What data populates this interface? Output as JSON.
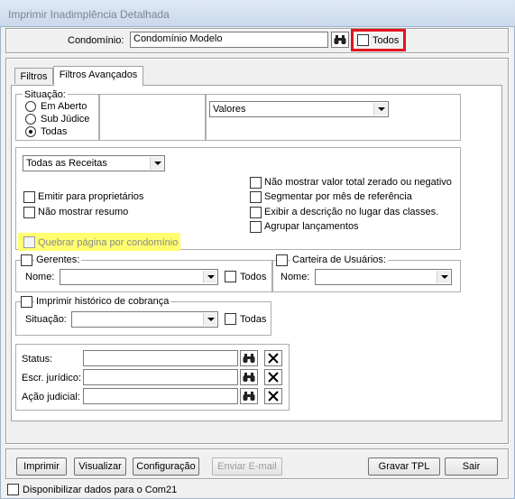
{
  "window": {
    "title": "Imprimir Inadimplência Detalhada"
  },
  "condominio": {
    "label": "Condomínio:",
    "value": "Condomínio Modelo",
    "todos_label": "Todos"
  },
  "tabs": [
    {
      "label": "Filtros"
    },
    {
      "label": "Filtros Avançados"
    }
  ],
  "situacao": {
    "label": "Situação:",
    "options": [
      "Em Aberto",
      "Sub Júdice",
      "Todas"
    ],
    "selected": "Todas"
  },
  "valores_combo": "Valores",
  "receitas_combo": "Todas as Receitas",
  "options_left": [
    "Emitir para proprietários",
    "Não mostrar resumo"
  ],
  "options_right": [
    "Não mostrar valor total zerado ou negativo",
    "Segmentar por mês de referência",
    "Exibir a descrição no lugar das classes.",
    "Agrupar lançamentos"
  ],
  "quebrar_pagina": "Quebrar página por condomínio",
  "gerentes": {
    "label": "Gerentes:",
    "nome_label": "Nome:",
    "todos_label": "Todos"
  },
  "carteira": {
    "label": "Carteira de Usuários:",
    "nome_label": "Nome:"
  },
  "historico": {
    "label": "Imprimir histórico de cobrança",
    "situacao_label": "Situação:",
    "todas_label": "Todas"
  },
  "juridico": {
    "fields": [
      {
        "label": "Status:"
      },
      {
        "label": "Escr. jurídico:"
      },
      {
        "label": "Ação judicial:"
      }
    ]
  },
  "buttons": {
    "imprimir": "Imprimir",
    "visualizar": "Visualizar",
    "configuracao": "Configuração",
    "enviar_email": "Enviar E-mail",
    "gravar_tpl": "Gravar TPL",
    "sair": "Sair"
  },
  "footer": {
    "disponibilizar": "Disponibilizar dados para o Com21"
  },
  "colors": {
    "highlight_red": "#e0141e",
    "highlight_yellow": "#ffff70"
  }
}
